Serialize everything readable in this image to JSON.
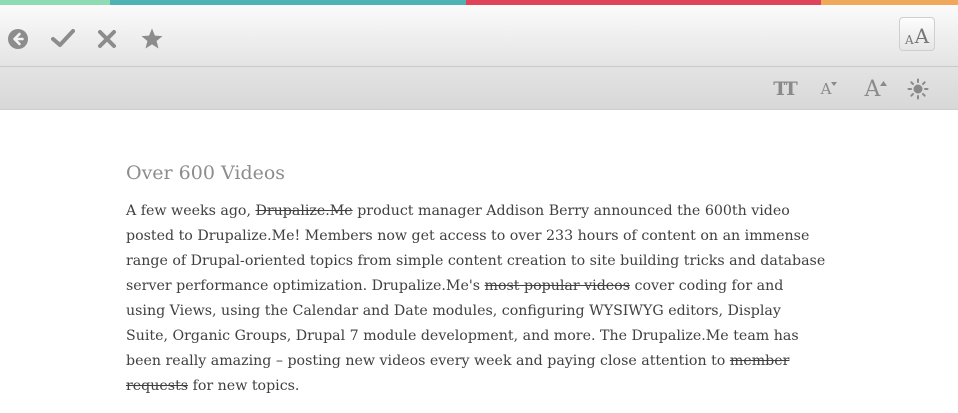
{
  "colors": {
    "bar_green": "#8fdcb4",
    "bar_teal": "#4fb3b3",
    "bar_red": "#e0445a",
    "bar_orange": "#f0a85a",
    "icon_gray": "#8c8c8c"
  },
  "toolbar": {
    "icons": [
      "back-circle-icon",
      "checkmark-icon",
      "close-icon",
      "star-icon"
    ],
    "font_toggle": {
      "small": "A",
      "big": "A"
    }
  },
  "text_settings": {
    "icons": [
      "font-family-icon",
      "decrease-font-size-icon",
      "increase-font-size-icon",
      "brightness-icon"
    ],
    "font_family_glyph": "TT",
    "decrease_glyph": "A",
    "increase_glyph": "A"
  },
  "article": {
    "title": "Over 600 Videos",
    "segments": [
      {
        "text": "A few weeks ago, ",
        "strike": false
      },
      {
        "text": "Drupalize.Me",
        "strike": true
      },
      {
        "text": " product manager Addison Berry announced the 600th video posted to Drupalize.Me! Members now get access to over 233 hours of content on an immense range of Drupal-oriented topics from simple content creation to site building tricks and database server performance optimization. Drupalize.Me's ",
        "strike": false
      },
      {
        "text": "most popular videos",
        "strike": true
      },
      {
        "text": " cover coding for and using Views, using the Calendar and Date modules, configuring WYSIWYG editors, Display Suite, Organic Groups, Drupal 7 module development, and more. The Drupalize.Me team has been really amazing – posting new videos every week and paying close attention to ",
        "strike": false
      },
      {
        "text": "member requests",
        "strike": true
      },
      {
        "text": " for new topics.",
        "strike": false
      }
    ]
  }
}
